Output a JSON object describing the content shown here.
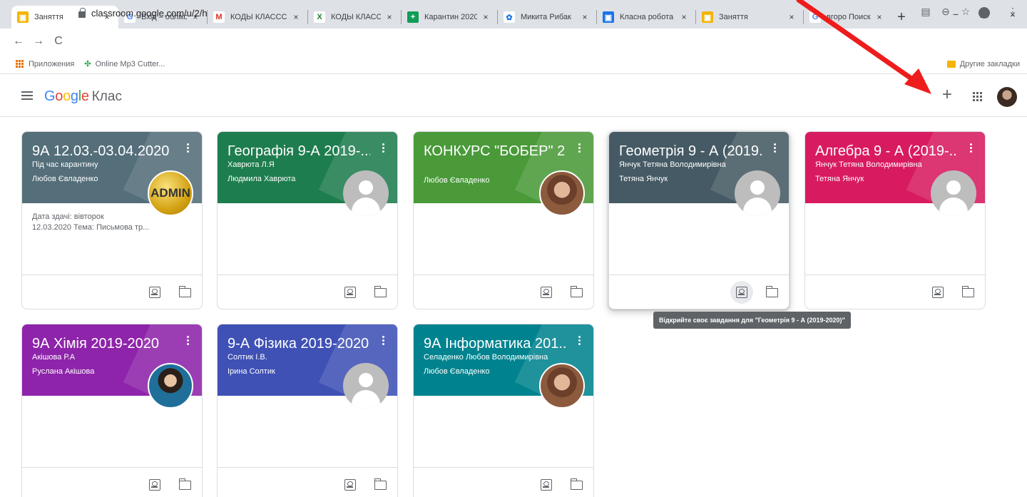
{
  "browser": {
    "tabs": [
      {
        "label": "Заняття",
        "fav_color": "#f4b400",
        "fav_glyph": "▣",
        "active": true,
        "width": 150
      },
      {
        "label": "Вхід – облікові",
        "fav_color": "#ffffff",
        "fav_glyph": "G",
        "fav_text": "#4285f4",
        "width": 124
      },
      {
        "label": "КОДЫ КЛАССС",
        "fav_color": "#ffffff",
        "fav_glyph": "M",
        "fav_text": "#d93025",
        "width": 140
      },
      {
        "label": "КОДЫ КЛАССС",
        "fav_color": "#ffffff",
        "fav_glyph": "X",
        "fav_text": "#188038",
        "width": 130
      },
      {
        "label": "Карантин 2020",
        "fav_color": "#0f9d58",
        "fav_glyph": "+",
        "width": 134
      },
      {
        "label": "Микита Рибак",
        "fav_color": "#ffffff",
        "fav_glyph": "✿",
        "fav_text": "#1a73e8",
        "width": 138
      },
      {
        "label": "Класна робота",
        "fav_color": "#1a73e8",
        "fav_glyph": "▣",
        "width": 138
      },
      {
        "label": "Заняття",
        "fav_color": "#f4b400",
        "fav_glyph": "▣",
        "width": 150
      },
      {
        "label": "вгоро Поиск",
        "fav_color": "#ffffff",
        "fav_glyph": "G",
        "fav_text": "#4285f4",
        "width": 122
      }
    ],
    "tab_close": "×",
    "new_tab": "+",
    "win_minimize": "−",
    "win_restore": "❐",
    "win_close": "×",
    "nav_back": "←",
    "nav_forward": "→",
    "nav_reload": "C",
    "url": "classroom.google.com/u/2/h",
    "translate_icon": "▤",
    "zoom_icon": "⊖",
    "star_icon": "☆",
    "menu_icon": "⋮",
    "bookmarks": {
      "apps_label": "Приложения",
      "mp3_label": "Online Mp3 Cutter...",
      "other_label": "Другие закладки"
    }
  },
  "app": {
    "logo_google": "Google",
    "logo_class": "Клас",
    "add_label": "+",
    "tooltip": "Відкрийте своє завдання для \"Геометрія 9 - А (2019-2020)\""
  },
  "colors": {
    "g_blue": "#4285f4",
    "g_red": "#ea4335",
    "g_yellow": "#fbbc05",
    "g_green": "#34a853",
    "arrow": "#ee1c1c"
  },
  "cards": [
    {
      "title": "9А 12.03.-03.04.2020",
      "section": "Під час карантину",
      "teacher": "Любов Євладенко",
      "color": "#546e7a",
      "body": [
        "Дата здачі: вівторок",
        "12.03.2020 Тема: Письмова тр..."
      ],
      "avatar": "admin",
      "avatar_text": "ADMIN"
    },
    {
      "title": "Географія 9-А 2019-...",
      "section": "Хаврюта Л.Я",
      "teacher": "Людмила Хаврюта",
      "color": "#1e7d4e",
      "body": [],
      "avatar": "default"
    },
    {
      "title": "КОНКУРС \"БОБЕР\" 2...",
      "section": "",
      "teacher": "Любов Євладенко",
      "color": "#4a9a3a",
      "body": [],
      "avatar": "photo"
    },
    {
      "title": "Геометрія 9 - А (2019...",
      "section": "Янчук Тетяна Володимирівна",
      "teacher": "Тетяна Янчук",
      "color": "#455a64",
      "body": [],
      "avatar": "default",
      "hover": true
    },
    {
      "title": "Алгебра 9 - А (2019-...",
      "section": "Янчук Тетяна Володимирівна",
      "teacher": "Тетяна Янчук",
      "color": "#d81b60",
      "body": [],
      "avatar": "default"
    },
    {
      "title": "9А Хімія 2019-2020",
      "section": "Акішова Р.А",
      "teacher": "Руслана Акішова",
      "color": "#8e24aa",
      "body": [],
      "avatar": "photo2"
    },
    {
      "title": "9-А Фізика 2019-2020",
      "section": "Солтик І.В.",
      "teacher": "Ірина Солтик",
      "color": "#3f51b5",
      "body": [],
      "avatar": "default"
    },
    {
      "title": "9А Інформатика 201...",
      "section": "Селаденко Любов Володимирівна",
      "teacher": "Любов Євладенко",
      "color": "#00838f",
      "body": [],
      "avatar": "photo"
    }
  ]
}
